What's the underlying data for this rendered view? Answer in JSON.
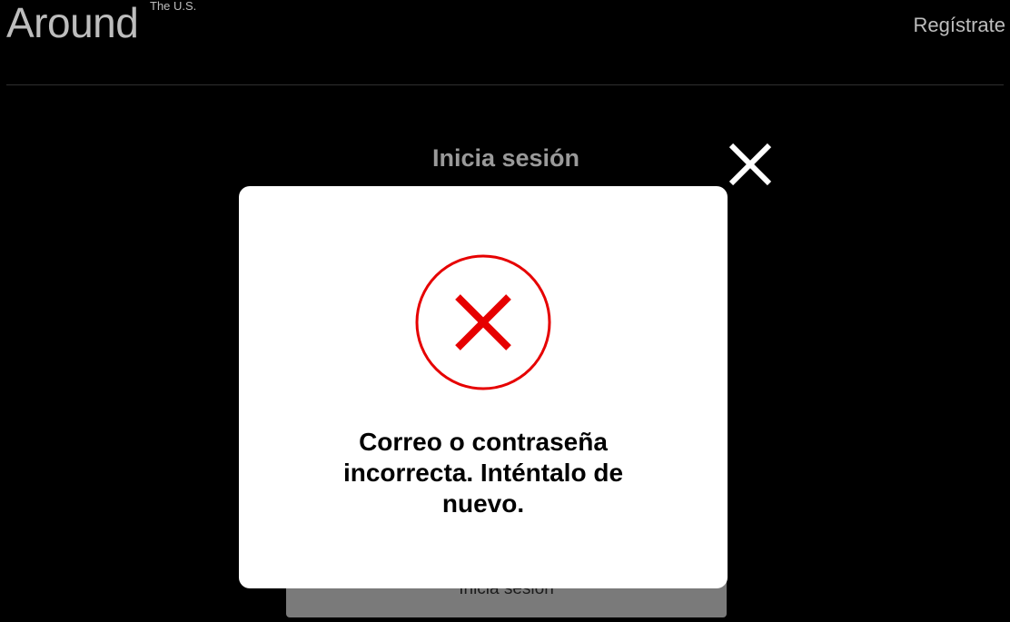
{
  "header": {
    "logo_text": "Around",
    "logo_superscript": "The U.S.",
    "register_label": "Regístrate"
  },
  "login": {
    "title": "Inicia sesión",
    "submit_label": "Inicia sesión"
  },
  "modal": {
    "message": "Correo o contraseña incorrecta. Inténtalo de nuevo.",
    "icon": "error-x-circle-icon"
  },
  "icons": {
    "close": "close-icon"
  },
  "colors": {
    "background": "#000000",
    "modal_background": "#ffffff",
    "error_red": "#e60000",
    "muted_text": "#bdbdbd",
    "button_gray": "#7a7a7a"
  }
}
